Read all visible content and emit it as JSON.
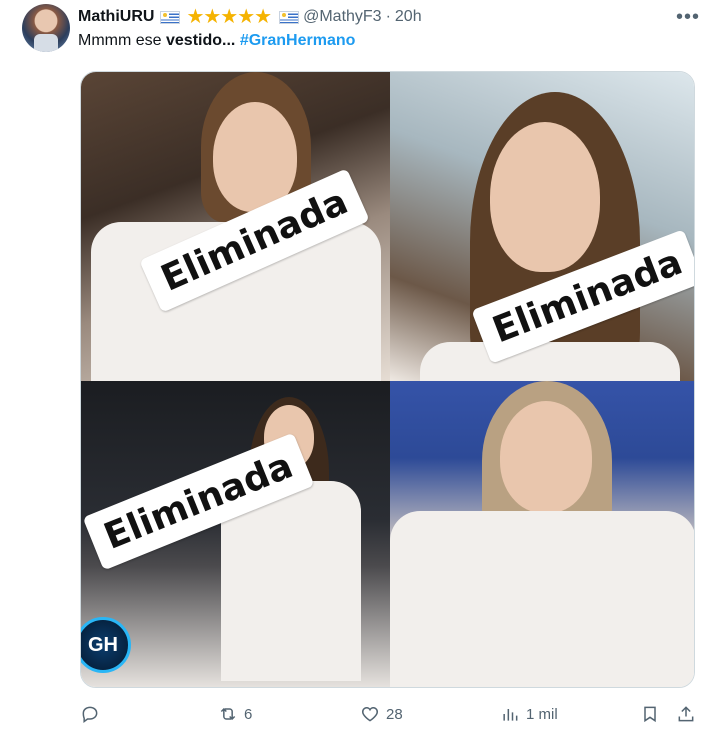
{
  "tweet": {
    "author_name": "MathiURU",
    "author_stars": "★★★★★",
    "handle": "@MathyF3",
    "separator": "·",
    "time": "20h",
    "text_prefix": "Mmmm ese ",
    "text_bold": "vestido...",
    "hashtag": "#GranHermano",
    "more": "•••"
  },
  "media": {
    "overlays": [
      "Eliminada",
      "Eliminada",
      "Eliminada"
    ],
    "logo": "GH"
  },
  "actions": {
    "reply_count": "",
    "retweet_count": "6",
    "like_count": "28",
    "views_count": "1 mil"
  },
  "colors": {
    "link": "#1d9bf0",
    "secondary_text": "#536471",
    "star": "#f5b301"
  }
}
